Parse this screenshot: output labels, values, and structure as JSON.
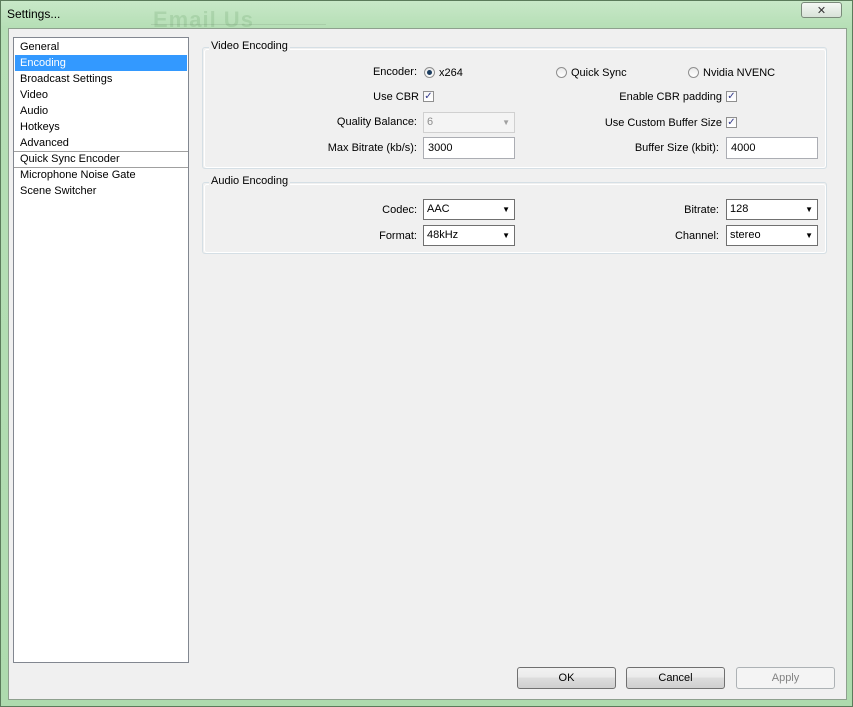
{
  "window": {
    "title": "Settings...",
    "background_text": "Email Us",
    "close_glyph": "✕"
  },
  "sidebar": {
    "items": [
      {
        "label": "General"
      },
      {
        "label": "Encoding",
        "selected": true
      },
      {
        "label": "Broadcast Settings"
      },
      {
        "label": "Video"
      },
      {
        "label": "Audio"
      },
      {
        "label": "Hotkeys"
      },
      {
        "label": "Advanced"
      },
      {
        "label": "Quick Sync Encoder"
      },
      {
        "label": "Microphone Noise Gate"
      },
      {
        "label": "Scene Switcher"
      }
    ]
  },
  "video": {
    "title": "Video Encoding",
    "encoder_label": "Encoder:",
    "encoder_options": [
      "x264",
      "Quick Sync",
      "Nvidia NVENC"
    ],
    "encoder_selected": "x264",
    "use_cbr_label": "Use CBR",
    "use_cbr_checked": true,
    "cbr_padding_label": "Enable CBR padding",
    "cbr_padding_checked": true,
    "quality_label": "Quality Balance:",
    "quality_value": "6",
    "custom_buffer_label": "Use Custom Buffer Size",
    "custom_buffer_checked": true,
    "max_bitrate_label": "Max Bitrate (kb/s):",
    "max_bitrate_value": "3000",
    "buffer_size_label": "Buffer Size (kbit):",
    "buffer_size_value": "4000"
  },
  "audio": {
    "title": "Audio Encoding",
    "codec_label": "Codec:",
    "codec_value": "AAC",
    "bitrate_label": "Bitrate:",
    "bitrate_value": "128",
    "format_label": "Format:",
    "format_value": "48kHz",
    "channel_label": "Channel:",
    "channel_value": "stereo"
  },
  "buttons": {
    "ok": "OK",
    "cancel": "Cancel",
    "apply": "Apply"
  },
  "glyphs": {
    "check": "✓",
    "dropdown": "▼"
  }
}
